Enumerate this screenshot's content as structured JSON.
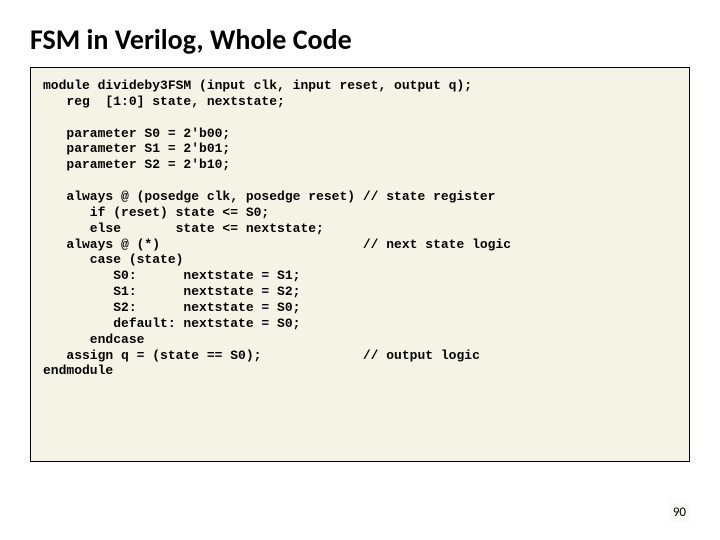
{
  "title": "FSM in Verilog, Whole Code",
  "code": "module divideby3FSM (input clk, input reset, output q);\n   reg  [1:0] state, nextstate;\n\n   parameter S0 = 2'b00;\n   parameter S1 = 2'b01;\n   parameter S2 = 2'b10;\n\n   always @ (posedge clk, posedge reset) // state register\n      if (reset) state <= S0;\n      else       state <= nextstate;\n   always @ (*)                          // next state logic\n      case (state)\n         S0:      nextstate = S1;\n         S1:      nextstate = S2;\n         S2:      nextstate = S0;\n         default: nextstate = S0;\n      endcase\n   assign q = (state == S0);             // output logic\nendmodule",
  "page_number": "90"
}
